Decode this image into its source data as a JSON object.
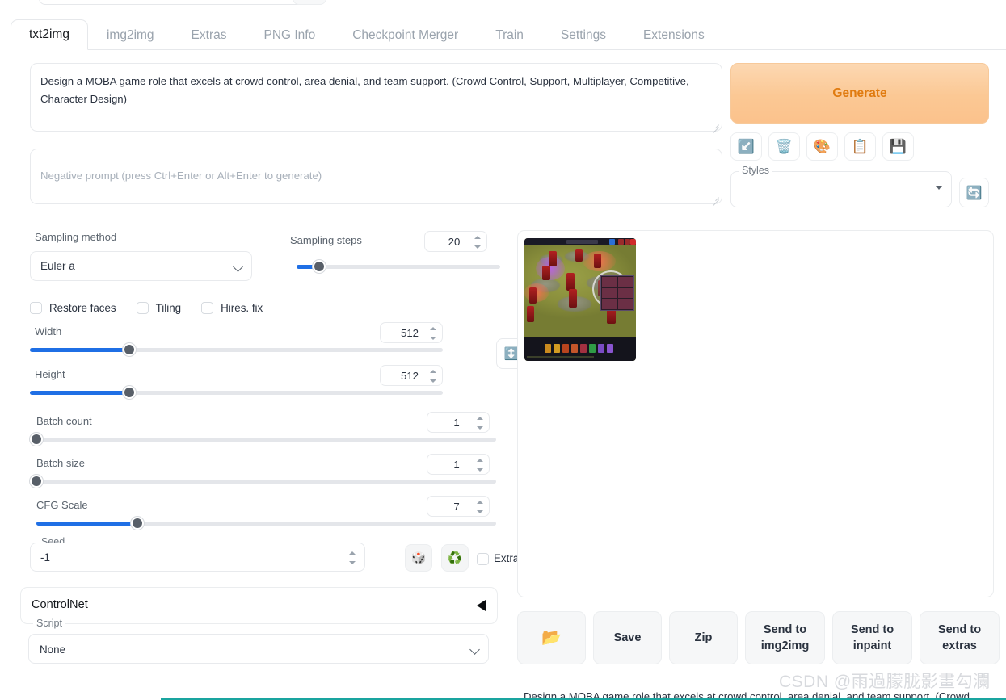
{
  "tabs": [
    {
      "label": "txt2img",
      "active": true
    },
    {
      "label": "img2img",
      "active": false
    },
    {
      "label": "Extras",
      "active": false
    },
    {
      "label": "PNG Info",
      "active": false
    },
    {
      "label": "Checkpoint Merger",
      "active": false
    },
    {
      "label": "Train",
      "active": false
    },
    {
      "label": "Settings",
      "active": false
    },
    {
      "label": "Extensions",
      "active": false
    }
  ],
  "prompt": {
    "value": "Design a MOBA game role that excels at crowd control, area denial, and team support. (Crowd Control, Support, Multiplayer, Competitive, Character Design)",
    "negative_placeholder": "Negative prompt (press Ctrl+Enter or Alt+Enter to generate)",
    "negative_value": ""
  },
  "generate": {
    "label": "Generate",
    "accent_color": "#e07b10",
    "background_color": "#fbc894"
  },
  "toolbar_icons": [
    {
      "name": "arrow-into-corner-icon",
      "glyph": "↙️"
    },
    {
      "name": "trash-icon",
      "glyph": "🗑️"
    },
    {
      "name": "paintbrush-icon",
      "glyph": "🎨"
    },
    {
      "name": "clipboard-icon",
      "glyph": "📋"
    },
    {
      "name": "save-icon",
      "glyph": "💾"
    }
  ],
  "styles": {
    "legend": "Styles",
    "value": "",
    "refresh_icon": "🔄"
  },
  "sampling": {
    "method_label": "Sampling method",
    "method_value": "Euler a",
    "steps_label": "Sampling steps",
    "steps_value": "20",
    "steps_percent": 11
  },
  "checkboxes": [
    {
      "label": "Restore faces",
      "checked": false
    },
    {
      "label": "Tiling",
      "checked": false
    },
    {
      "label": "Hires. fix",
      "checked": false
    }
  ],
  "dimensions": {
    "width_label": "Width",
    "width_value": "512",
    "width_percent": 24,
    "height_label": "Height",
    "height_value": "512",
    "height_percent": 24,
    "swap_icon": "↕️"
  },
  "batch": {
    "count_label": "Batch count",
    "count_value": "1",
    "count_percent": 0,
    "size_label": "Batch size",
    "size_value": "1",
    "size_percent": 0,
    "cfg_label": "CFG Scale",
    "cfg_value": "7",
    "cfg_percent": 22
  },
  "seed": {
    "legend": "Seed",
    "value": "-1",
    "dice_icon": "🎲",
    "recycle_icon": "♻️",
    "extra_label": "Extra",
    "extra_checked": false
  },
  "controlnet": {
    "title": "ControlNet",
    "collapsed": true
  },
  "script": {
    "legend": "Script",
    "value": "None"
  },
  "gallery": {
    "image_alt": "MOBA game scene with red characters on circular platforms"
  },
  "actions": [
    {
      "label": "📂",
      "name": "open-folder-button",
      "icon": true
    },
    {
      "label": "Save",
      "name": "save-button",
      "icon": false
    },
    {
      "label": "Zip",
      "name": "zip-button",
      "icon": false
    },
    {
      "label": "Send to img2img",
      "name": "send-to-img2img-button",
      "icon": false
    },
    {
      "label": "Send to inpaint",
      "name": "send-to-inpaint-button",
      "icon": false
    },
    {
      "label": "Send to extras",
      "name": "send-to-extras-button",
      "icon": false
    }
  ],
  "footer": {
    "watermark": "CSDN @雨過朦胧影畫勾瀾",
    "cut_text": "Design a MOBA game role that excels at crowd control, area denial, and team support. (Crowd"
  }
}
